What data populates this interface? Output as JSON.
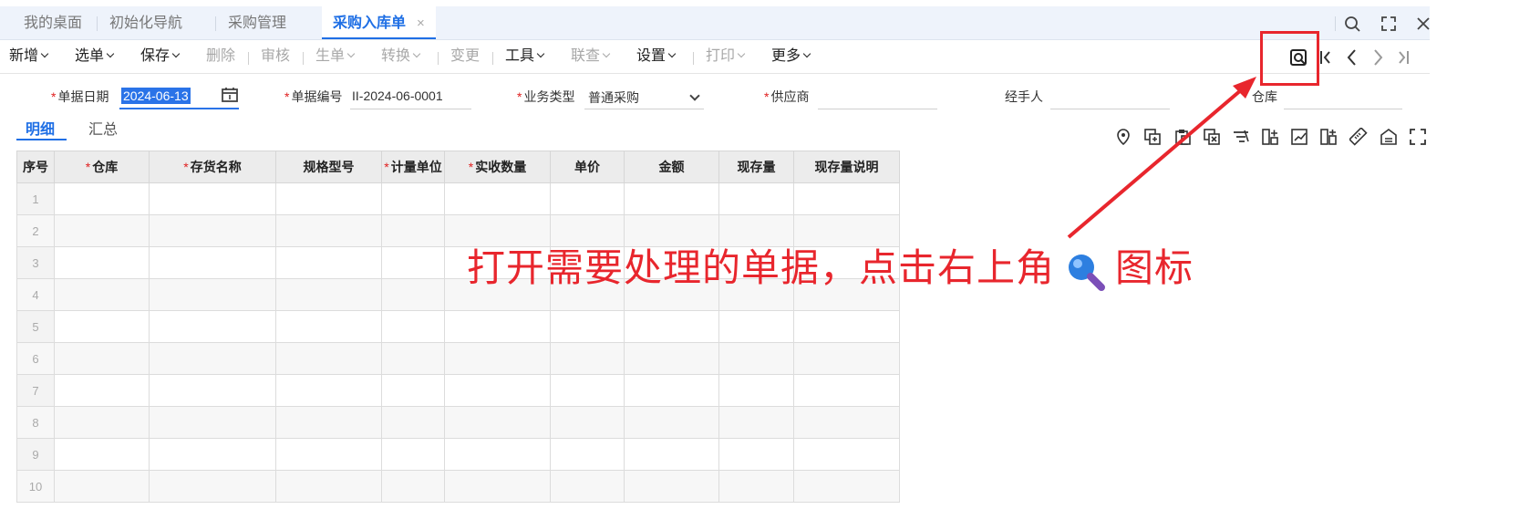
{
  "tabs": [
    {
      "label": "我的桌面",
      "active": false
    },
    {
      "label": "初始化导航",
      "active": false
    },
    {
      "label": "采购管理",
      "active": false
    },
    {
      "label": "采购入库单",
      "active": true
    }
  ],
  "tab_close": "×",
  "window_icons": [
    "search-icon",
    "fullscreen-icon",
    "close-icon"
  ],
  "toolbar": {
    "buttons": [
      {
        "label": "新增",
        "dropdown": true,
        "disabled": false
      },
      {
        "label": "选单",
        "dropdown": true,
        "disabled": false
      },
      {
        "label": "保存",
        "dropdown": true,
        "disabled": false
      },
      {
        "label": "删除",
        "dropdown": false,
        "disabled": true
      },
      {
        "label": "审核",
        "dropdown": false,
        "disabled": true
      },
      {
        "label": "生单",
        "dropdown": true,
        "disabled": true
      },
      {
        "label": "转换",
        "dropdown": true,
        "disabled": true
      },
      {
        "label": "变更",
        "dropdown": false,
        "disabled": true
      },
      {
        "label": "工具",
        "dropdown": true,
        "disabled": false
      },
      {
        "label": "联查",
        "dropdown": true,
        "disabled": true
      },
      {
        "label": "设置",
        "dropdown": true,
        "disabled": false
      },
      {
        "label": "打印",
        "dropdown": true,
        "disabled": true
      },
      {
        "label": "更多",
        "dropdown": true,
        "disabled": false
      }
    ],
    "nav_icons": [
      "document-search-icon",
      "first-record-icon",
      "previous-record-icon",
      "next-record-icon",
      "last-record-icon"
    ]
  },
  "form": {
    "date": {
      "label": "单据日期",
      "value": "2024-06-13",
      "required": true
    },
    "number": {
      "label": "单据编号",
      "value": "II-2024-06-0001",
      "required": true
    },
    "biz_type": {
      "label": "业务类型",
      "value": "普通采购",
      "required": true
    },
    "supplier": {
      "label": "供应商",
      "value": "",
      "required": true
    },
    "handler": {
      "label": "经手人",
      "value": "",
      "required": false
    },
    "warehouse": {
      "label": "仓库",
      "value": "",
      "required": false
    }
  },
  "subtabs": [
    {
      "label": "明细",
      "active": true
    },
    {
      "label": "汇总",
      "active": false
    }
  ],
  "grid_icons": [
    "location-pin-icon",
    "add-row-icon",
    "paste-icon",
    "delete-row-icon",
    "filter-icon",
    "split-icon",
    "chart-icon",
    "insert-column-icon",
    "ruler-icon",
    "warehouse-icon",
    "expand-icon"
  ],
  "table": {
    "columns": [
      {
        "label": "序号",
        "required": false
      },
      {
        "label": "仓库",
        "required": true
      },
      {
        "label": "存货名称",
        "required": true
      },
      {
        "label": "规格型号",
        "required": false
      },
      {
        "label": "计量单位",
        "required": true
      },
      {
        "label": "实收数量",
        "required": true
      },
      {
        "label": "单价",
        "required": false
      },
      {
        "label": "金额",
        "required": false
      },
      {
        "label": "现存量",
        "required": false
      },
      {
        "label": "现存量说明",
        "required": false
      }
    ],
    "rows": [
      "1",
      "2",
      "3",
      "4",
      "5",
      "6",
      "7",
      "8",
      "9",
      "10"
    ]
  },
  "annotation": {
    "text_before": "打开需要处理的单据，点击右上角",
    "text_after": "图标",
    "color": "#e8262d"
  },
  "colors": {
    "accent": "#1f6fe5",
    "required": "#e02020",
    "annotation": "#e8262d"
  }
}
